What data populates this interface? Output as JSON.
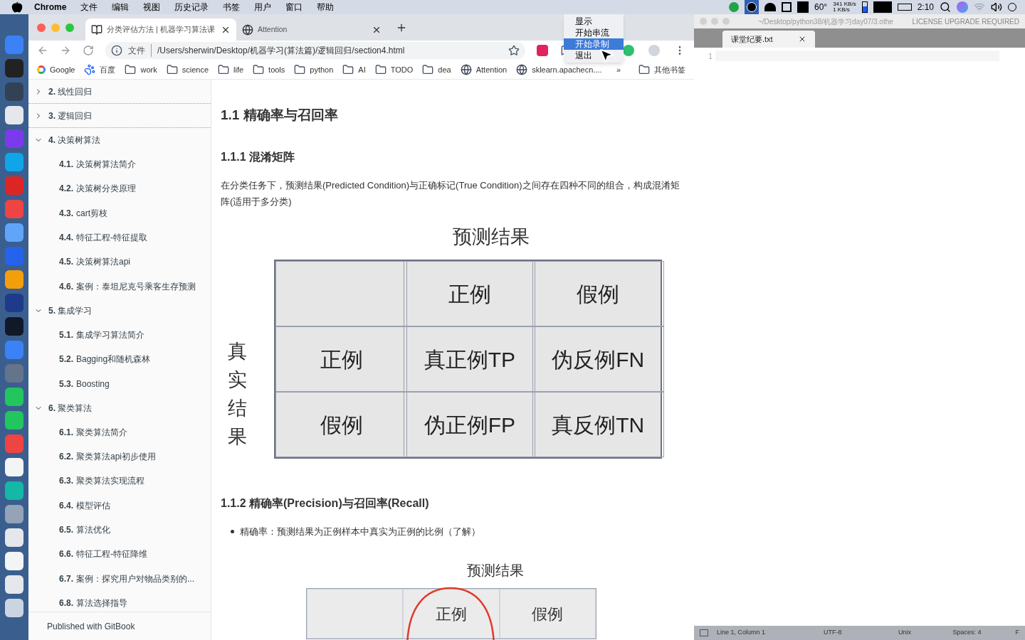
{
  "menu_bar": {
    "app": "Chrome",
    "menus": [
      "文件",
      "编辑",
      "视图",
      "历史记录",
      "书签",
      "用户",
      "窗口",
      "帮助"
    ],
    "temperature": "60°",
    "net_up": "341 KB/s",
    "net_down": "1 KB/s",
    "time": "2:10"
  },
  "status_menu": {
    "items": [
      {
        "label": "显示",
        "selected": false
      },
      {
        "label": "开始串流",
        "selected": false
      },
      {
        "label": "开始录制",
        "selected": true
      },
      {
        "label": "退出",
        "selected": false
      }
    ]
  },
  "browser": {
    "tabs": [
      {
        "title": "分类评估方法 | 机器学习算法课",
        "selected": true,
        "kind": "book"
      },
      {
        "title": "Attention",
        "selected": false,
        "kind": "globe"
      }
    ],
    "address": {
      "scheme": "文件",
      "url": "/Users/sherwin/Desktop/机器学习(算法篇)/逻辑回归/section4.html"
    },
    "bookmarks": [
      {
        "label": "Google",
        "kind": "google"
      },
      {
        "label": "百度",
        "kind": "paw"
      },
      {
        "label": "work",
        "kind": "folder"
      },
      {
        "label": "science",
        "kind": "folder"
      },
      {
        "label": "life",
        "kind": "folder"
      },
      {
        "label": "tools",
        "kind": "folder"
      },
      {
        "label": "python",
        "kind": "folder"
      },
      {
        "label": "AI",
        "kind": "folder"
      },
      {
        "label": "TODO",
        "kind": "folder"
      },
      {
        "label": "dea",
        "kind": "folder"
      },
      {
        "label": "Attention",
        "kind": "globe"
      },
      {
        "label": "sklearn.apachecn....",
        "kind": "globe"
      }
    ],
    "overflow": "»",
    "other_bookmarks": "其他书签"
  },
  "sidebar": {
    "items": [
      {
        "number": "2.",
        "title": "线性回归",
        "expanded": false
      },
      {
        "number": "3.",
        "title": "逻辑回归",
        "expanded": false
      },
      {
        "number": "4.",
        "title": "决策树算法",
        "expanded": true,
        "children": [
          {
            "number": "4.1.",
            "title": "决策树算法简介"
          },
          {
            "number": "4.2.",
            "title": "决策树分类原理"
          },
          {
            "number": "4.3.",
            "title": "cart剪枝"
          },
          {
            "number": "4.4.",
            "title": "特征工程-特征提取"
          },
          {
            "number": "4.5.",
            "title": "决策树算法api"
          },
          {
            "number": "4.6.",
            "title": "案例：泰坦尼克号乘客生存预测"
          }
        ]
      },
      {
        "number": "5.",
        "title": "集成学习",
        "expanded": true,
        "children": [
          {
            "number": "5.1.",
            "title": "集成学习算法简介"
          },
          {
            "number": "5.2.",
            "title": "Bagging和随机森林"
          },
          {
            "number": "5.3.",
            "title": "Boosting"
          }
        ]
      },
      {
        "number": "6.",
        "title": "聚类算法",
        "expanded": true,
        "children": [
          {
            "number": "6.1.",
            "title": "聚类算法简介"
          },
          {
            "number": "6.2.",
            "title": "聚类算法api初步使用"
          },
          {
            "number": "6.3.",
            "title": "聚类算法实现流程"
          },
          {
            "number": "6.4.",
            "title": "模型评估"
          },
          {
            "number": "6.5.",
            "title": "算法优化"
          },
          {
            "number": "6.6.",
            "title": "特征工程-特征降维"
          },
          {
            "number": "6.7.",
            "title": "案例：探究用户对物品类别的..."
          },
          {
            "number": "6.8.",
            "title": "算法选择指导"
          }
        ]
      }
    ],
    "footer": "Published with GitBook"
  },
  "article": {
    "heading": "1.1 精确率与召回率",
    "section_1": "1.1.1 混淆矩阵",
    "paragraph": "在分类任务下，预测结果(Predicted Condition)与正确标记(True Condition)之间存在四种不同的组合，构成混淆矩阵(适用于多分类)",
    "matrix": {
      "top_label": "预测结果",
      "side_label": "真实结果",
      "header": [
        "正例",
        "假例"
      ],
      "rows": [
        {
          "label": "正例",
          "cells": [
            "真正例TP",
            "伪反例FN"
          ]
        },
        {
          "label": "假例",
          "cells": [
            "伪正例FP",
            "真反例TN"
          ]
        }
      ]
    },
    "section_2": "1.1.2 精确率(Precision)与召回率(Recall)",
    "bullets": [
      "精确率：预测结果为正例样本中真实为正例的比例（了解）"
    ],
    "matrix_2": {
      "top_label": "预测结果",
      "header": [
        "正例",
        "假例"
      ]
    }
  },
  "editor": {
    "title": "~/Desktop/python38/机器学习day07/3.othe",
    "license": "LICENSE UPGRADE REQUIRED",
    "tab": "课堂纪要.txt",
    "line_numbers": [
      "1"
    ],
    "status": [
      "Line 1, Column 1",
      "UTF-8",
      "Unix",
      "Spaces: 4",
      "F"
    ]
  }
}
